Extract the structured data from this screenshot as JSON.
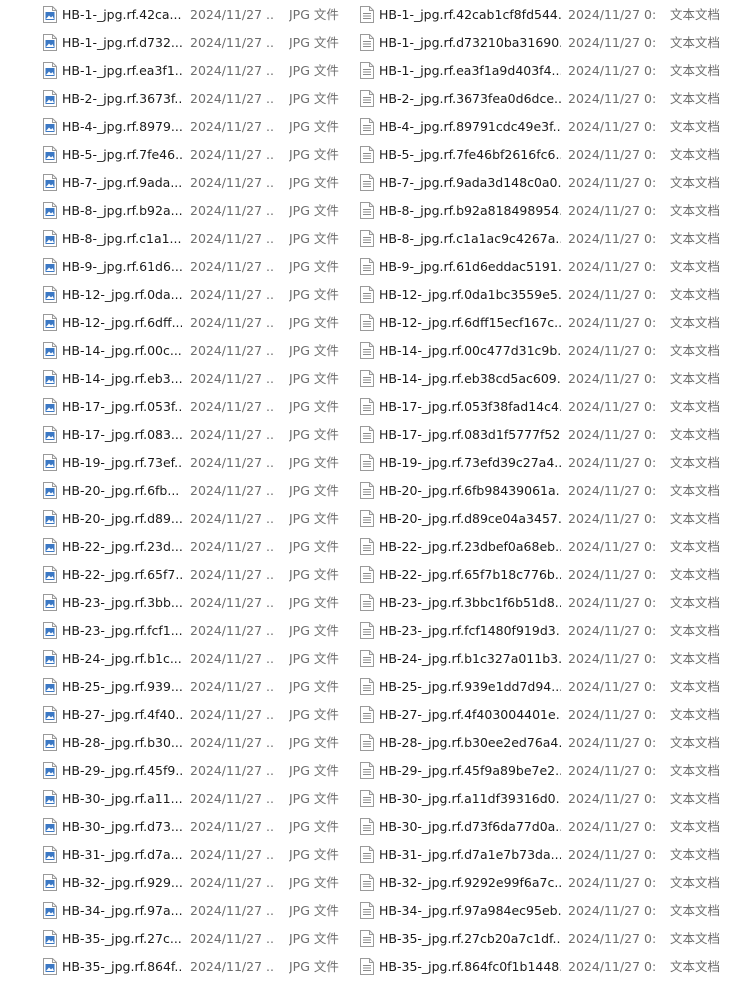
{
  "colors": {
    "jpg_icon_accent": "#3b78c4",
    "text_icon_accent": "#8a8a8a"
  },
  "icons": {
    "jpg_file": "image-file-icon",
    "text_file": "text-document-icon"
  },
  "left_pane": {
    "rows": [
      {
        "name": "HB-1-_jpg.rf.42ca...",
        "date": "2024/11/27 ...",
        "type": "JPG 文件"
      },
      {
        "name": "HB-1-_jpg.rf.d732...",
        "date": "2024/11/27 ...",
        "type": "JPG 文件"
      },
      {
        "name": "HB-1-_jpg.rf.ea3f1...",
        "date": "2024/11/27 ...",
        "type": "JPG 文件"
      },
      {
        "name": "HB-2-_jpg.rf.3673f...",
        "date": "2024/11/27 ...",
        "type": "JPG 文件"
      },
      {
        "name": "HB-4-_jpg.rf.8979...",
        "date": "2024/11/27 ...",
        "type": "JPG 文件"
      },
      {
        "name": "HB-5-_jpg.rf.7fe46...",
        "date": "2024/11/27 ...",
        "type": "JPG 文件"
      },
      {
        "name": "HB-7-_jpg.rf.9ada...",
        "date": "2024/11/27 ...",
        "type": "JPG 文件"
      },
      {
        "name": "HB-8-_jpg.rf.b92a...",
        "date": "2024/11/27 ...",
        "type": "JPG 文件"
      },
      {
        "name": "HB-8-_jpg.rf.c1a1...",
        "date": "2024/11/27 ...",
        "type": "JPG 文件"
      },
      {
        "name": "HB-9-_jpg.rf.61d6...",
        "date": "2024/11/27 ...",
        "type": "JPG 文件"
      },
      {
        "name": "HB-12-_jpg.rf.0da...",
        "date": "2024/11/27 ...",
        "type": "JPG 文件"
      },
      {
        "name": "HB-12-_jpg.rf.6dff...",
        "date": "2024/11/27 ...",
        "type": "JPG 文件"
      },
      {
        "name": "HB-14-_jpg.rf.00c...",
        "date": "2024/11/27 ...",
        "type": "JPG 文件"
      },
      {
        "name": "HB-14-_jpg.rf.eb3...",
        "date": "2024/11/27 ...",
        "type": "JPG 文件"
      },
      {
        "name": "HB-17-_jpg.rf.053f...",
        "date": "2024/11/27 ...",
        "type": "JPG 文件"
      },
      {
        "name": "HB-17-_jpg.rf.083...",
        "date": "2024/11/27 ...",
        "type": "JPG 文件"
      },
      {
        "name": "HB-19-_jpg.rf.73ef...",
        "date": "2024/11/27 ...",
        "type": "JPG 文件"
      },
      {
        "name": "HB-20-_jpg.rf.6fb...",
        "date": "2024/11/27 ...",
        "type": "JPG 文件"
      },
      {
        "name": "HB-20-_jpg.rf.d89...",
        "date": "2024/11/27 ...",
        "type": "JPG 文件"
      },
      {
        "name": "HB-22-_jpg.rf.23d...",
        "date": "2024/11/27 ...",
        "type": "JPG 文件"
      },
      {
        "name": "HB-22-_jpg.rf.65f7...",
        "date": "2024/11/27 ...",
        "type": "JPG 文件"
      },
      {
        "name": "HB-23-_jpg.rf.3bb...",
        "date": "2024/11/27 ...",
        "type": "JPG 文件"
      },
      {
        "name": "HB-23-_jpg.rf.fcf1...",
        "date": "2024/11/27 ...",
        "type": "JPG 文件"
      },
      {
        "name": "HB-24-_jpg.rf.b1c...",
        "date": "2024/11/27 ...",
        "type": "JPG 文件"
      },
      {
        "name": "HB-25-_jpg.rf.939...",
        "date": "2024/11/27 ...",
        "type": "JPG 文件"
      },
      {
        "name": "HB-27-_jpg.rf.4f40...",
        "date": "2024/11/27 ...",
        "type": "JPG 文件"
      },
      {
        "name": "HB-28-_jpg.rf.b30...",
        "date": "2024/11/27 ...",
        "type": "JPG 文件"
      },
      {
        "name": "HB-29-_jpg.rf.45f9...",
        "date": "2024/11/27 ...",
        "type": "JPG 文件"
      },
      {
        "name": "HB-30-_jpg.rf.a11...",
        "date": "2024/11/27 ...",
        "type": "JPG 文件"
      },
      {
        "name": "HB-30-_jpg.rf.d73...",
        "date": "2024/11/27 ...",
        "type": "JPG 文件"
      },
      {
        "name": "HB-31-_jpg.rf.d7a...",
        "date": "2024/11/27 ...",
        "type": "JPG 文件"
      },
      {
        "name": "HB-32-_jpg.rf.929...",
        "date": "2024/11/27 ...",
        "type": "JPG 文件"
      },
      {
        "name": "HB-34-_jpg.rf.97a...",
        "date": "2024/11/27 ...",
        "type": "JPG 文件"
      },
      {
        "name": "HB-35-_jpg.rf.27c...",
        "date": "2024/11/27 ...",
        "type": "JPG 文件"
      },
      {
        "name": "HB-35-_jpg.rf.864f...",
        "date": "2024/11/27 ...",
        "type": "JPG 文件"
      }
    ]
  },
  "right_pane": {
    "rows": [
      {
        "name": "HB-1-_jpg.rf.42cab1cf8fd544...",
        "date": "2024/11/27 0:...",
        "type": "文本文档"
      },
      {
        "name": "HB-1-_jpg.rf.d73210ba31690...",
        "date": "2024/11/27 0:...",
        "type": "文本文档"
      },
      {
        "name": "HB-1-_jpg.rf.ea3f1a9d403f4...",
        "date": "2024/11/27 0:...",
        "type": "文本文档"
      },
      {
        "name": "HB-2-_jpg.rf.3673fea0d6dce...",
        "date": "2024/11/27 0:...",
        "type": "文本文档"
      },
      {
        "name": "HB-4-_jpg.rf.89791cdc49e3f...",
        "date": "2024/11/27 0:...",
        "type": "文本文档"
      },
      {
        "name": "HB-5-_jpg.rf.7fe46bf2616fc6...",
        "date": "2024/11/27 0:...",
        "type": "文本文档"
      },
      {
        "name": "HB-7-_jpg.rf.9ada3d148c0a0...",
        "date": "2024/11/27 0:...",
        "type": "文本文档"
      },
      {
        "name": "HB-8-_jpg.rf.b92a818498954...",
        "date": "2024/11/27 0:...",
        "type": "文本文档"
      },
      {
        "name": "HB-8-_jpg.rf.c1a1ac9c4267a...",
        "date": "2024/11/27 0:...",
        "type": "文本文档"
      },
      {
        "name": "HB-9-_jpg.rf.61d6eddac5191...",
        "date": "2024/11/27 0:...",
        "type": "文本文档"
      },
      {
        "name": "HB-12-_jpg.rf.0da1bc3559e5...",
        "date": "2024/11/27 0:...",
        "type": "文本文档"
      },
      {
        "name": "HB-12-_jpg.rf.6dff15ecf167c...",
        "date": "2024/11/27 0:...",
        "type": "文本文档"
      },
      {
        "name": "HB-14-_jpg.rf.00c477d31c9b...",
        "date": "2024/11/27 0:...",
        "type": "文本文档"
      },
      {
        "name": "HB-14-_jpg.rf.eb38cd5ac609...",
        "date": "2024/11/27 0:...",
        "type": "文本文档"
      },
      {
        "name": "HB-17-_jpg.rf.053f38fad14c4...",
        "date": "2024/11/27 0:...",
        "type": "文本文档"
      },
      {
        "name": "HB-17-_jpg.rf.083d1f5777f52...",
        "date": "2024/11/27 0:...",
        "type": "文本文档"
      },
      {
        "name": "HB-19-_jpg.rf.73efd39c27a4...",
        "date": "2024/11/27 0:...",
        "type": "文本文档"
      },
      {
        "name": "HB-20-_jpg.rf.6fb98439061a...",
        "date": "2024/11/27 0:...",
        "type": "文本文档"
      },
      {
        "name": "HB-20-_jpg.rf.d89ce04a3457...",
        "date": "2024/11/27 0:...",
        "type": "文本文档"
      },
      {
        "name": "HB-22-_jpg.rf.23dbef0a68eb...",
        "date": "2024/11/27 0:...",
        "type": "文本文档"
      },
      {
        "name": "HB-22-_jpg.rf.65f7b18c776b...",
        "date": "2024/11/27 0:...",
        "type": "文本文档"
      },
      {
        "name": "HB-23-_jpg.rf.3bbc1f6b51d8...",
        "date": "2024/11/27 0:...",
        "type": "文本文档"
      },
      {
        "name": "HB-23-_jpg.rf.fcf1480f919d3...",
        "date": "2024/11/27 0:...",
        "type": "文本文档"
      },
      {
        "name": "HB-24-_jpg.rf.b1c327a011b3...",
        "date": "2024/11/27 0:...",
        "type": "文本文档"
      },
      {
        "name": "HB-25-_jpg.rf.939e1dd7d94...",
        "date": "2024/11/27 0:...",
        "type": "文本文档"
      },
      {
        "name": "HB-27-_jpg.rf.4f403004401e...",
        "date": "2024/11/27 0:...",
        "type": "文本文档"
      },
      {
        "name": "HB-28-_jpg.rf.b30ee2ed76a4...",
        "date": "2024/11/27 0:...",
        "type": "文本文档"
      },
      {
        "name": "HB-29-_jpg.rf.45f9a89be7e2...",
        "date": "2024/11/27 0:...",
        "type": "文本文档"
      },
      {
        "name": "HB-30-_jpg.rf.a11df39316d0...",
        "date": "2024/11/27 0:...",
        "type": "文本文档"
      },
      {
        "name": "HB-30-_jpg.rf.d73f6da77d0a...",
        "date": "2024/11/27 0:...",
        "type": "文本文档"
      },
      {
        "name": "HB-31-_jpg.rf.d7a1e7b73da...",
        "date": "2024/11/27 0:...",
        "type": "文本文档"
      },
      {
        "name": "HB-32-_jpg.rf.9292e99f6a7c...",
        "date": "2024/11/27 0:...",
        "type": "文本文档"
      },
      {
        "name": "HB-34-_jpg.rf.97a984ec95eb...",
        "date": "2024/11/27 0:...",
        "type": "文本文档"
      },
      {
        "name": "HB-35-_jpg.rf.27cb20a7c1df...",
        "date": "2024/11/27 0:...",
        "type": "文本文档"
      },
      {
        "name": "HB-35-_jpg.rf.864fc0f1b1448...",
        "date": "2024/11/27 0:...",
        "type": "文本文档"
      }
    ]
  }
}
